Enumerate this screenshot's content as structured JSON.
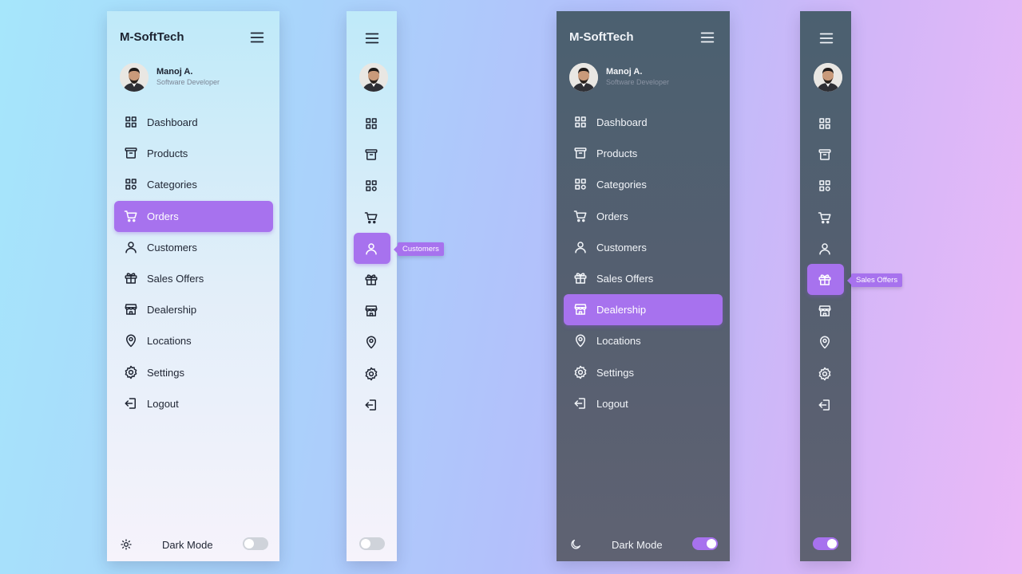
{
  "brand": "M-SoftTech",
  "user": {
    "name": "Manoj A.",
    "role": "Software Developer"
  },
  "menu": [
    {
      "label": "Dashboard",
      "icon": "dashboard-icon"
    },
    {
      "label": "Products",
      "icon": "archive-box-icon"
    },
    {
      "label": "Categories",
      "icon": "categories-icon"
    },
    {
      "label": "Orders",
      "icon": "cart-icon"
    },
    {
      "label": "Customers",
      "icon": "user-icon"
    },
    {
      "label": "Sales Offers",
      "icon": "gift-icon"
    },
    {
      "label": "Dealership",
      "icon": "store-icon"
    },
    {
      "label": "Locations",
      "icon": "location-pin-icon"
    },
    {
      "label": "Settings",
      "icon": "gear-icon"
    },
    {
      "label": "Logout",
      "icon": "logout-icon"
    }
  ],
  "footer": {
    "dark_mode_label": "Dark Mode"
  },
  "panels": {
    "light_expanded": {
      "active": "Orders",
      "dark_mode_on": false
    },
    "light_collapsed": {
      "active": "Customers",
      "tooltip": "Customers",
      "dark_mode_on": false
    },
    "dark_expanded": {
      "active": "Dealership",
      "dark_mode_on": true
    },
    "dark_collapsed": {
      "active": "Sales Offers",
      "tooltip": "Sales Offers",
      "dark_mode_on": true
    }
  },
  "colors": {
    "accent": "#a772ee",
    "dark_panel": "#555f70",
    "light_panel": "#e2eef9"
  }
}
